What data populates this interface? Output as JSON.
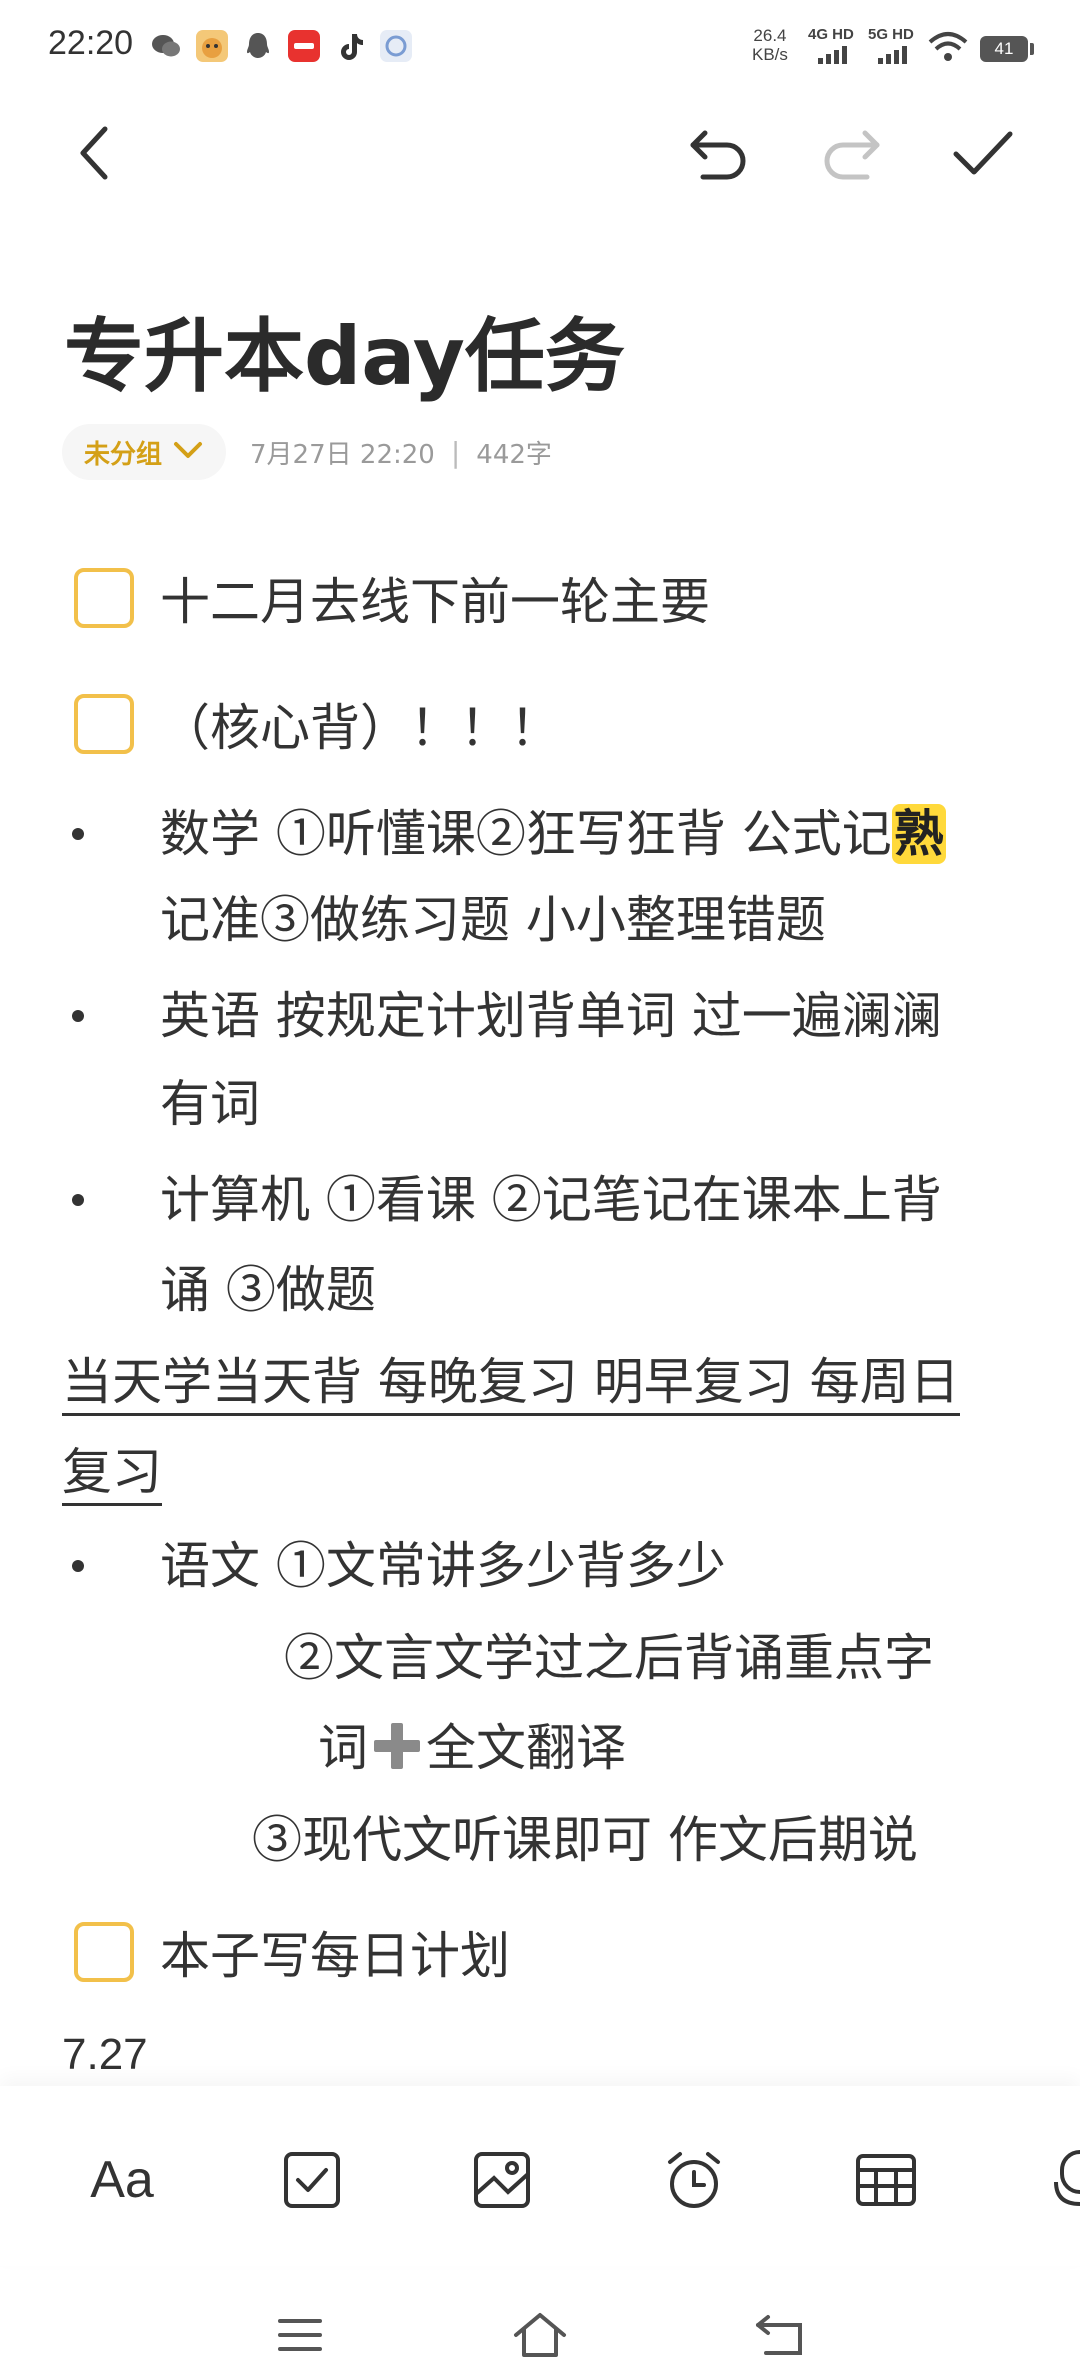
{
  "status_bar": {
    "time": "22:20",
    "net_speed_value": "26.4",
    "net_speed_unit": "KB/s",
    "sim1_label": "4G HD",
    "sim2_label": "5G HD",
    "battery": "41",
    "app_icons": [
      "wechat-icon",
      "avatar-icon",
      "qq-icon",
      "xiaohongshu-icon",
      "tiktok-icon",
      "app-icon"
    ]
  },
  "toolbar": {
    "back": "back-icon",
    "undo": "undo-icon",
    "redo": "redo-icon",
    "done": "check-icon"
  },
  "note": {
    "title": "专升本day任务",
    "group": "未分组",
    "date": "7月27日 22:20",
    "separator": "|",
    "word_count": "442字"
  },
  "content": {
    "todo_1": "十二月去线下前一轮主要",
    "todo_2": "（核心背）！！！",
    "math_line1_a": "数学 ①听懂课②狂写狂背 公式记",
    "math_emoji": "熟",
    "math_line2": "记准③做练习题 小小整理错题",
    "english_line1": "英语 按规定计划背单词 过一遍澜澜",
    "english_line2": "有词",
    "computer_line1": "计算机 ①看课 ②记笔记在课本上背",
    "computer_line2": "诵 ③做题",
    "review_line1": "当天学当天背 每晚复习 明早复习 每周日",
    "review_line2": "复习",
    "chinese_line1": "语文  ①文常讲多少背多少",
    "chinese_line2": "②文言文学过之后背诵重点字",
    "chinese_line3a": "词",
    "chinese_line3b": "全文翻译",
    "chinese_line4": "③现代文听课即可 作文后期说",
    "todo_3": "本子写每日计划",
    "date_text": "7.27"
  },
  "bottom_toolbar": {
    "font_label": "Aa",
    "items": [
      "font-style",
      "checklist-icon",
      "image-icon",
      "alarm-icon",
      "table-icon",
      "mic-icon"
    ]
  },
  "nav": [
    "menu-icon",
    "home-icon",
    "back-nav-icon"
  ]
}
